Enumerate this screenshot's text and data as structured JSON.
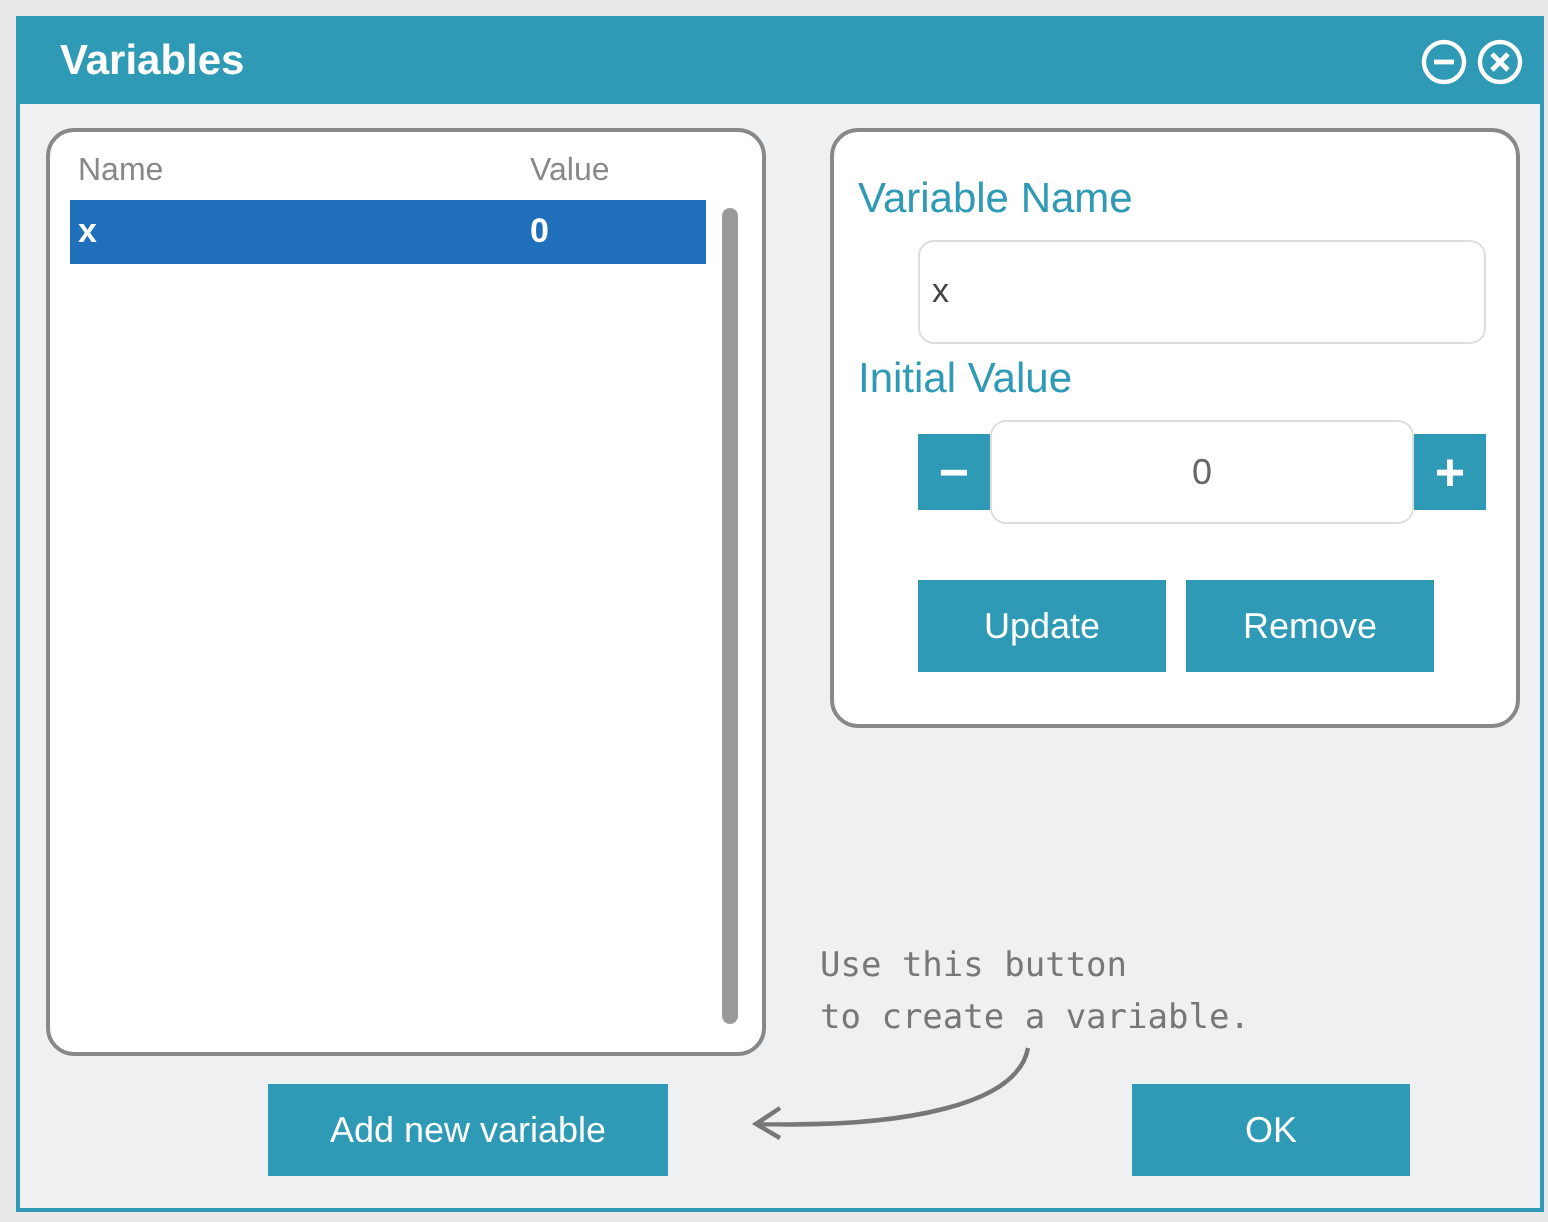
{
  "window": {
    "title": "Variables"
  },
  "list": {
    "columns": [
      "Name",
      "Value"
    ],
    "rows": [
      {
        "name": "x",
        "value": "0",
        "selected": true
      }
    ]
  },
  "editor": {
    "name_label": "Variable Name",
    "name_value": "x",
    "initial_label": "Initial Value",
    "initial_value": "0",
    "decrement": "−",
    "increment": "+",
    "buttons": [
      "Update",
      "Remove"
    ]
  },
  "add_button": "Add new variable",
  "ok_button": "OK",
  "hint": "Use this button\nto create a variable."
}
